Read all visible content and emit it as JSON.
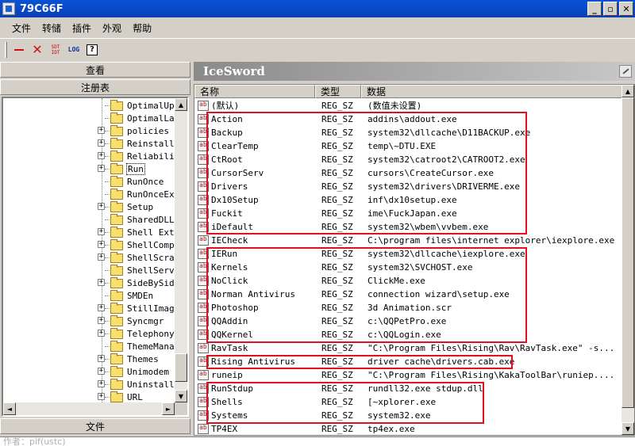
{
  "window": {
    "title": "79C66F"
  },
  "window_buttons": {
    "minimize": "_",
    "maximize": "▫",
    "close": "✕"
  },
  "menu": [
    "文件",
    "转储",
    "插件",
    "外观",
    "帮助"
  ],
  "toolbar": {
    "sdt_label": "SDT\nIDT",
    "log_label": "LOG",
    "help_label": "?"
  },
  "left": {
    "view_label": "查看",
    "registry_label": "注册表",
    "file_label": "文件",
    "tree": [
      {
        "label": "OptimalUpdat",
        "expander": ""
      },
      {
        "label": "OptimalLayo",
        "expander": ""
      },
      {
        "label": "policies",
        "expander": "+"
      },
      {
        "label": "Reinstall",
        "expander": "+"
      },
      {
        "label": "Reliability",
        "expander": "+"
      },
      {
        "label": "Run",
        "expander": "+",
        "selected": true
      },
      {
        "label": "RunOnce",
        "expander": ""
      },
      {
        "label": "RunOnceEx",
        "expander": ""
      },
      {
        "label": "Setup",
        "expander": "+"
      },
      {
        "label": "SharedDLLs",
        "expander": ""
      },
      {
        "label": "Shell Exten",
        "expander": "+"
      },
      {
        "label": "ShellCompat",
        "expander": "+"
      },
      {
        "label": "ShellScrap",
        "expander": "+"
      },
      {
        "label": "ShellServic",
        "expander": ""
      },
      {
        "label": "SideBySide",
        "expander": "+"
      },
      {
        "label": "SMDEn",
        "expander": ""
      },
      {
        "label": "StillImage",
        "expander": "+"
      },
      {
        "label": "Syncmgr",
        "expander": "+"
      },
      {
        "label": "Telephony",
        "expander": "+"
      },
      {
        "label": "ThemeManage",
        "expander": ""
      },
      {
        "label": "Themes",
        "expander": "+"
      },
      {
        "label": "Unimodem",
        "expander": "+"
      },
      {
        "label": "Uninstall",
        "expander": "+"
      },
      {
        "label": "URL",
        "expander": "+"
      }
    ]
  },
  "right": {
    "header": "IceSword",
    "columns": [
      "名称",
      "类型",
      "数据"
    ],
    "rows": [
      [
        "(默认)",
        "REG_SZ",
        "(数值未设置)"
      ],
      [
        "Action",
        "REG_SZ",
        "addins\\addout.exe"
      ],
      [
        "Backup",
        "REG_SZ",
        "system32\\dllcache\\D11BACKUP.exe"
      ],
      [
        "ClearTemp",
        "REG_SZ",
        "temp\\~DTU.EXE"
      ],
      [
        "CtRoot",
        "REG_SZ",
        "system32\\catroot2\\CATROOT2.exe"
      ],
      [
        "CursorServ",
        "REG_SZ",
        "cursors\\CreateCursor.exe"
      ],
      [
        "Drivers",
        "REG_SZ",
        "system32\\drivers\\DRIVERME.exe"
      ],
      [
        "Dx10Setup",
        "REG_SZ",
        "inf\\dx10setup.exe"
      ],
      [
        "Fuckit",
        "REG_SZ",
        "ime\\FuckJapan.exe"
      ],
      [
        "iDefault",
        "REG_SZ",
        "system32\\wbem\\vvbem.exe"
      ],
      [
        "IECheck",
        "REG_SZ",
        "C:\\program files\\internet explorer\\iexplore.exe"
      ],
      [
        "IERun",
        "REG_SZ",
        "system32\\dllcache\\iexplore.exe"
      ],
      [
        "Kernels",
        "REG_SZ",
        "system32\\SVCHOST.exe"
      ],
      [
        "NoClick",
        "REG_SZ",
        "ClickMe.exe"
      ],
      [
        "Norman Antivirus",
        "REG_SZ",
        "connection wizard\\setup.exe"
      ],
      [
        "Photoshop",
        "REG_SZ",
        "3d Animation.scr"
      ],
      [
        "QQAddin",
        "REG_SZ",
        "c:\\QQPetPro.exe"
      ],
      [
        "QQKernel",
        "REG_SZ",
        "c:\\QQLogin.exe"
      ],
      [
        "RavTask",
        "REG_SZ",
        "\"C:\\Program Files\\Rising\\Rav\\RavTask.exe\" -s..."
      ],
      [
        "Rising Antivirus",
        "REG_SZ",
        "driver cache\\drivers.cab.exe"
      ],
      [
        "runeip",
        "REG_SZ",
        "\"C:\\Program Files\\Rising\\KakaToolBar\\runiep...."
      ],
      [
        "RunStdup",
        "REG_SZ",
        "rundll32.exe stdup.dll"
      ],
      [
        "Shells",
        "REG_SZ",
        "[~xplorer.exe"
      ],
      [
        "Systems",
        "REG_SZ",
        "system32.exe"
      ],
      [
        "TP4EX",
        "REG_SZ",
        "tp4ex.exe"
      ]
    ]
  },
  "status_text": "作者：pif(ustc)",
  "colors": {
    "titlebar": "#0a52d6",
    "highlight_box": "#e01020",
    "panel": "#d4d0c8"
  }
}
